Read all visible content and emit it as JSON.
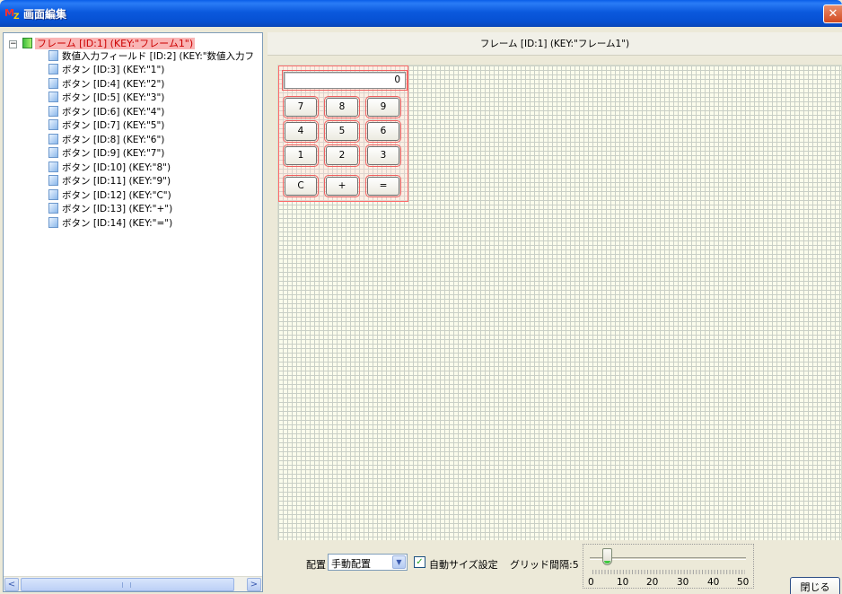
{
  "window": {
    "title": "画面編集",
    "icon_letters": "M",
    "icon_sub": "Z",
    "close_glyph": "✕"
  },
  "tree": {
    "expander_glyph": "−",
    "root_label": "フレーム [ID:1] (KEY:\"フレーム1\")",
    "children": [
      "数値入力フィールド [ID:2] (KEY:\"数値入力フ",
      "ボタン [ID:3] (KEY:\"1\")",
      "ボタン [ID:4] (KEY:\"2\")",
      "ボタン [ID:5] (KEY:\"3\")",
      "ボタン [ID:6] (KEY:\"4\")",
      "ボタン [ID:7] (KEY:\"5\")",
      "ボタン [ID:8] (KEY:\"6\")",
      "ボタン [ID:9] (KEY:\"7\")",
      "ボタン [ID:10] (KEY:\"8\")",
      "ボタン [ID:11] (KEY:\"9\")",
      "ボタン [ID:12] (KEY:\"C\")",
      "ボタン [ID:13] (KEY:\"+\")",
      "ボタン [ID:14] (KEY:\"=\")"
    ],
    "scroll_left_glyph": "<",
    "scroll_right_glyph": ">"
  },
  "canvas": {
    "header": "フレーム [ID:1] (KEY:\"フレーム1\")",
    "number_field_value": "0",
    "buttons": {
      "b7": "7",
      "b8": "8",
      "b9": "9",
      "b4": "4",
      "b5": "5",
      "b6": "6",
      "b1": "1",
      "b2": "2",
      "b3": "3",
      "bc": "C",
      "bplus": "+",
      "beq": "="
    }
  },
  "toolbar": {
    "layout_label": "配置",
    "layout_value": "手動配置",
    "dropdown_glyph": "▼",
    "auto_size_checked": true,
    "check_glyph": "✓",
    "auto_size_label": "自動サイズ設定",
    "grid_label": "グリッド間隔:5",
    "slider": {
      "min": 0,
      "max": 50,
      "value": 5,
      "labels": [
        "0",
        "10",
        "20",
        "30",
        "40",
        "50"
      ]
    },
    "close_label": "閉じる"
  }
}
